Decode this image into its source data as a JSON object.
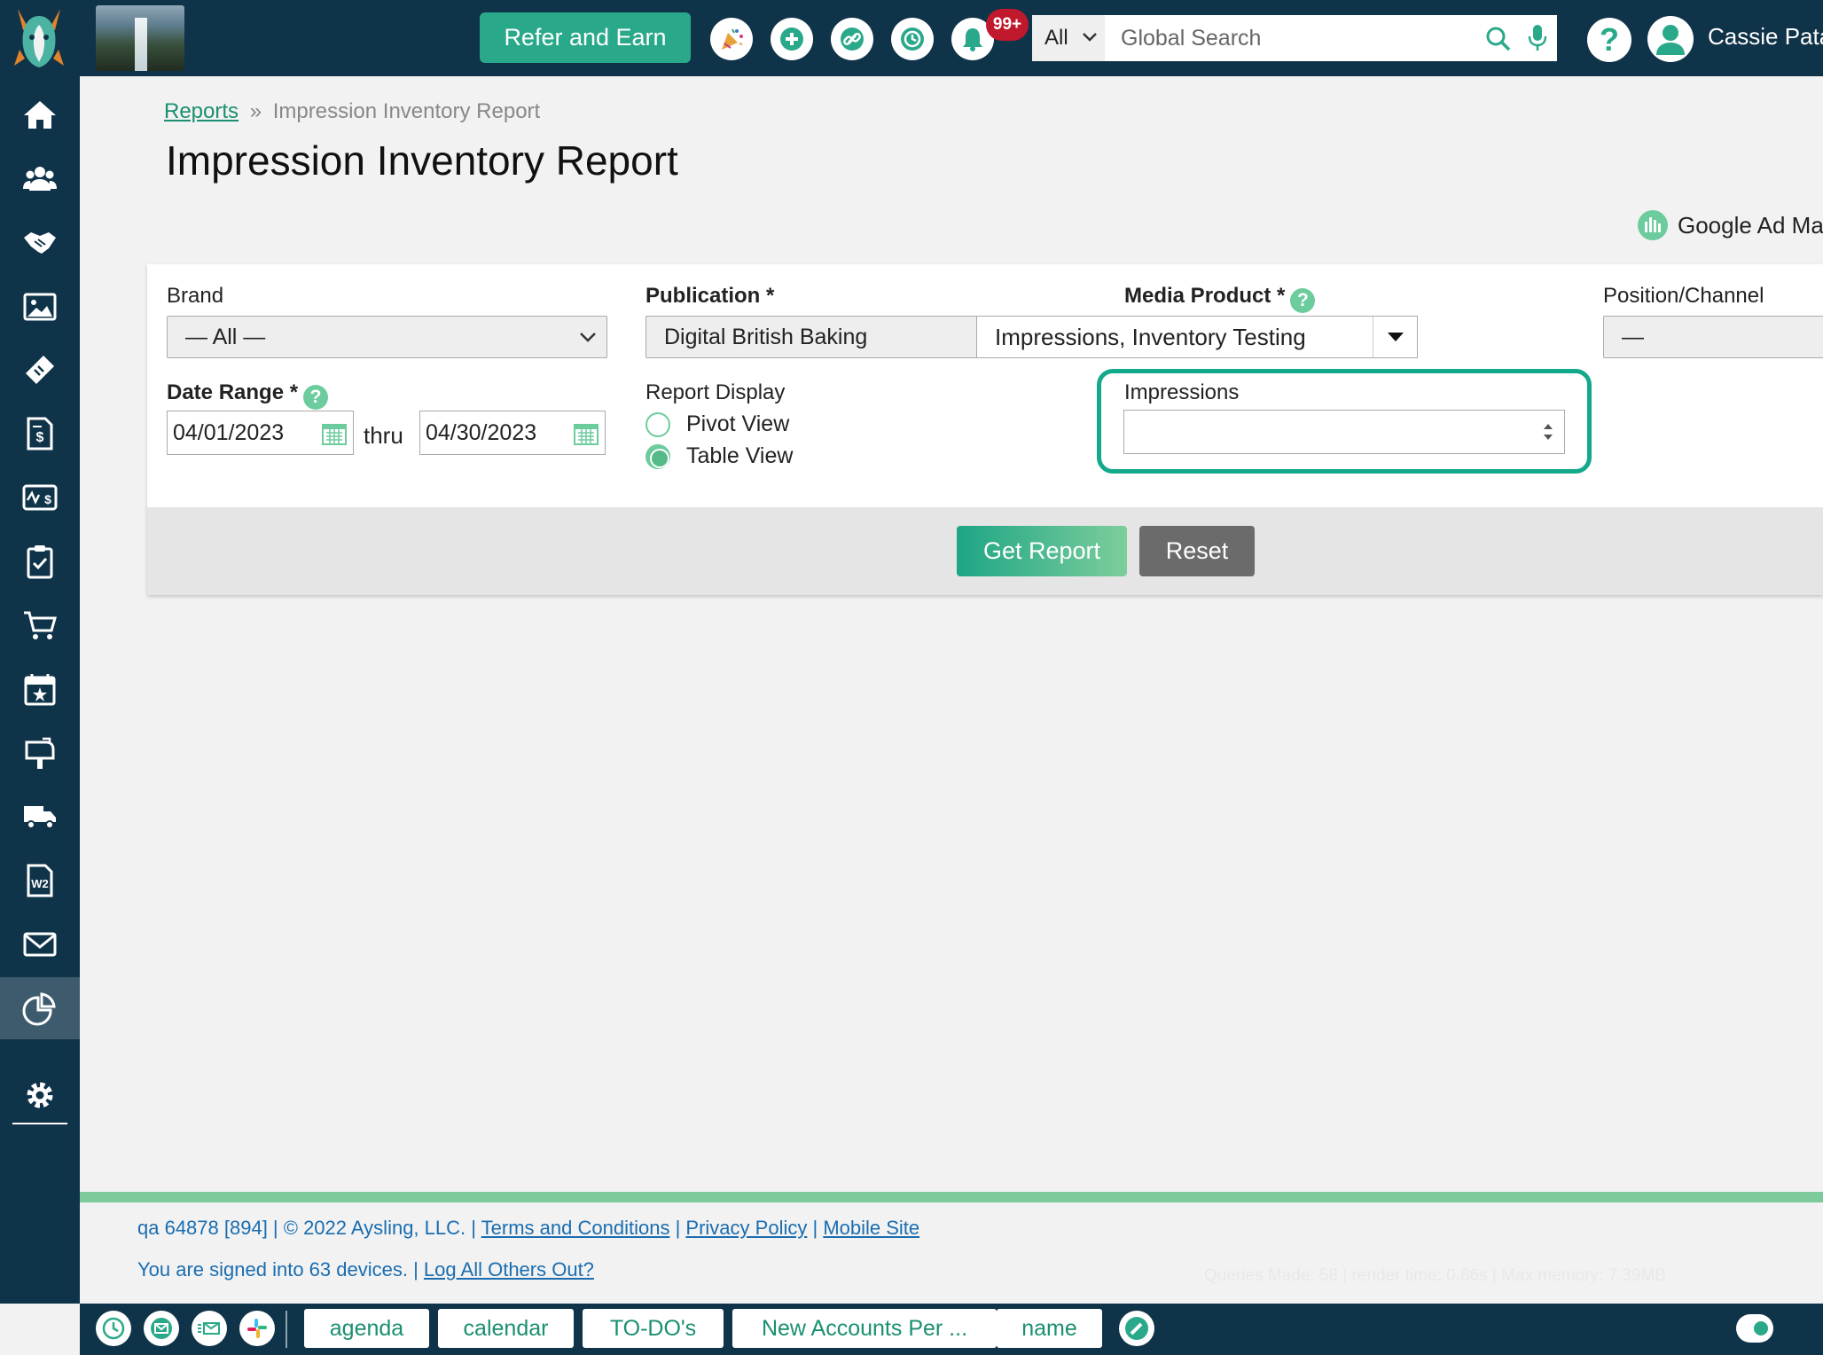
{
  "header": {
    "refer_label": "Refer and Earn",
    "notification_count": "99+",
    "search_scope": "All",
    "search_placeholder": "Global Search",
    "user_name": "Cassie Pata"
  },
  "breadcrumb": {
    "root": "Reports",
    "separator": "»",
    "current": "Impression Inventory Report"
  },
  "page_title": "Impression Inventory Report",
  "integration_label": "Google Ad Ma",
  "form": {
    "brand_label": "Brand",
    "brand_value": "— All —",
    "publication_label": "Publication *",
    "publication_value": "Digital British Baking",
    "media_product_label": "Media Product *",
    "media_product_value": "Impressions, Inventory Testing",
    "position_label": "Position/Channel",
    "position_value": "—",
    "date_range_label": "Date Range *",
    "date_from": "04/01/2023",
    "thru_label": "thru",
    "date_to": "04/30/2023",
    "report_display_label": "Report Display",
    "pivot_label": "Pivot View",
    "table_label": "Table View",
    "impressions_label": "Impressions",
    "impressions_value": "",
    "help_glyph": "?"
  },
  "buttons": {
    "get_report": "Get Report",
    "reset": "Reset"
  },
  "footer": {
    "build": "qa 64878 [894] | © 2022 Aysling, LLC. |",
    "sep": "|",
    "terms": "Terms and Conditions",
    "privacy": "Privacy Policy",
    "mobile": "Mobile Site",
    "signed_in": "You are signed into 63 devices. |",
    "log_out": "Log All Others Out?",
    "stats": "Queries Made: 58 | render time: 0.86s | Max memory: 7.39MB"
  },
  "bottom_tabs": [
    "agenda",
    "calendar",
    "TO-DO's",
    "New Accounts Per ...",
    "name"
  ],
  "colors": {
    "navy": "#0f3349",
    "accent": "#2aa98a",
    "highlight": "#14a98a",
    "footer_line": "#7dcb9a"
  }
}
